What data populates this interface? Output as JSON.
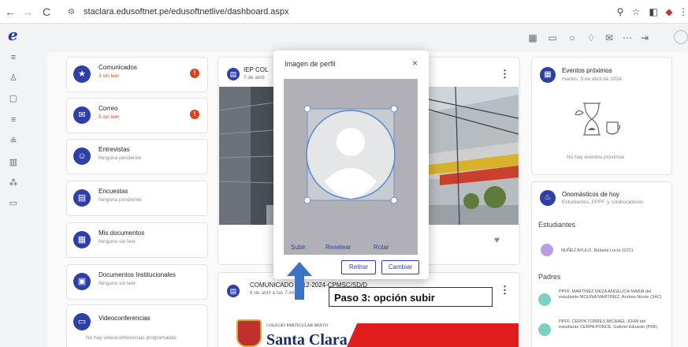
{
  "browser": {
    "url": "staclara.edusoftnet.pe/edusoftnetlive/dashboard.aspx",
    "nav": {
      "back": "←",
      "forward": "→",
      "reload": "C"
    }
  },
  "app": {
    "logo": "e"
  },
  "left_cards": [
    {
      "title": "Comunicados",
      "sub": "3 sin leer",
      "alert": "!",
      "icon": "★"
    },
    {
      "title": "Correo",
      "sub": "5 sin leer",
      "alert": "!",
      "icon": "✉"
    },
    {
      "title": "Entrevistas",
      "sub": "Ninguna pendiente",
      "icon": "☺"
    },
    {
      "title": "Encuestas",
      "sub": "Ninguna pendiente",
      "icon": "▤"
    },
    {
      "title": "Mis documentos",
      "sub": "Ninguno sin leer",
      "icon": "▦"
    },
    {
      "title": "Documentos Institucionales",
      "sub": "Ninguno sin leer",
      "icon": "▣"
    },
    {
      "title": "Videoconferencias",
      "sub": "No hay videoconferencias programadas",
      "icon": "▭"
    }
  ],
  "feed": {
    "post1": {
      "title": "IEP COL",
      "date": "7 de abril"
    },
    "post2": {
      "title": "COMUNICADO N°12-2024-CPMSC/SD/D",
      "date": "6 de abril a las 7:46",
      "school_small": "COLEGIO PARTICULAR MIXTO",
      "school_big": "Santa Clara"
    }
  },
  "modal": {
    "title": "Imagen de perfil",
    "close": "×",
    "links": {
      "upload": "Subir",
      "reset": "Resetear",
      "rotate": "Rotar"
    },
    "buttons": {
      "remove": "Retirar",
      "change": "Cambiar"
    }
  },
  "right": {
    "events": {
      "title": "Eventos próximos",
      "date": "martes, 9 de abril de 2024",
      "empty": "No hay eventos próximos"
    },
    "birthdays": {
      "title": "Onomásticos de hoy",
      "sub": "Estudiantes, PPFF. y colaboradores"
    },
    "students_label": "Estudiantes",
    "student": "NUÑEZ AYULO, Rafaela Lucía (S1C)",
    "parents_label": "Padres",
    "parent1": "PPFF. MARTINEZ MEZA ANGELICA MARIA del estudiante MOLINA MARTINEZ, Andrea Nicole (S4C)",
    "parent2": "PPFF. CERPA TORRES MICHAEL JOHN del estudiante CERPA PONCE, Gabriel Eduardo (P6B)"
  },
  "annotation": {
    "text": "Paso 3: opción subir"
  },
  "colors": {
    "brand": "#2f3fa8",
    "alert": "#d8421c",
    "annotation_arrow": "#3b74c4",
    "annotation_banner": "#e01d1d"
  },
  "icons": {
    "chrome": [
      "zoom-icon",
      "star-icon",
      "sidepanel-icon",
      "extension-icon",
      "menu-icon"
    ],
    "top": [
      "calendar-icon",
      "chat-icon",
      "search-icon",
      "bell-icon",
      "mail-icon",
      "apps-icon",
      "logout-icon",
      "avatar-icon"
    ],
    "rail": [
      "search-list-icon",
      "person-icon",
      "clipboard-icon",
      "menu-lines-icon",
      "people-list-icon",
      "building-icon",
      "group-icon",
      "card-icon"
    ]
  }
}
